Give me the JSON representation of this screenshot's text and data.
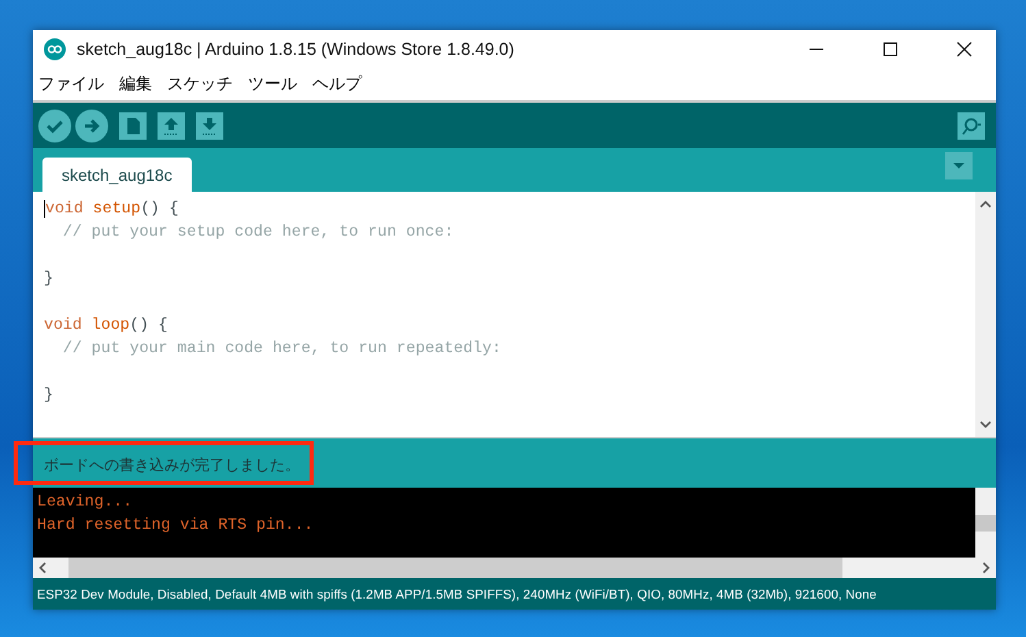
{
  "window": {
    "title": "sketch_aug18c | Arduino 1.8.15 (Windows Store 1.8.49.0)"
  },
  "menu": [
    "ファイル",
    "編集",
    "スケッチ",
    "ツール",
    "ヘルプ"
  ],
  "tabs": [
    {
      "label": "sketch_aug18c",
      "selected": true
    }
  ],
  "editor": {
    "lines": [
      {
        "kind": "code",
        "tokens": [
          {
            "text": "void ",
            "kind": "keyword"
          },
          {
            "text": "setup",
            "kind": "function"
          },
          {
            "text": "() {",
            "kind": "plain"
          }
        ]
      },
      {
        "kind": "code",
        "tokens": [
          {
            "text": "  // put your setup code here, to run once:",
            "kind": "comment"
          }
        ]
      },
      {
        "kind": "blank"
      },
      {
        "kind": "code",
        "tokens": [
          {
            "text": "}",
            "kind": "plain"
          }
        ]
      },
      {
        "kind": "blank"
      },
      {
        "kind": "code",
        "tokens": [
          {
            "text": "void ",
            "kind": "keyword"
          },
          {
            "text": "loop",
            "kind": "function"
          },
          {
            "text": "() {",
            "kind": "plain"
          }
        ]
      },
      {
        "kind": "code",
        "tokens": [
          {
            "text": "  // put your main code here, to run repeatedly:",
            "kind": "comment"
          }
        ]
      },
      {
        "kind": "blank"
      },
      {
        "kind": "code",
        "tokens": [
          {
            "text": "}",
            "kind": "plain"
          }
        ]
      }
    ]
  },
  "message": {
    "text": "ボードへの書き込みが完了しました。",
    "highlighted": true
  },
  "console": {
    "lines": [
      "Leaving...",
      "Hard resetting via RTS pin..."
    ]
  },
  "status_bar": "ESP32 Dev Module, Disabled, Default 4MB with spiffs (1.2MB APP/1.5MB SPIFFS), 240MHz (WiFi/BT), QIO, 80MHz, 4MB (32Mb), 921600, None"
}
